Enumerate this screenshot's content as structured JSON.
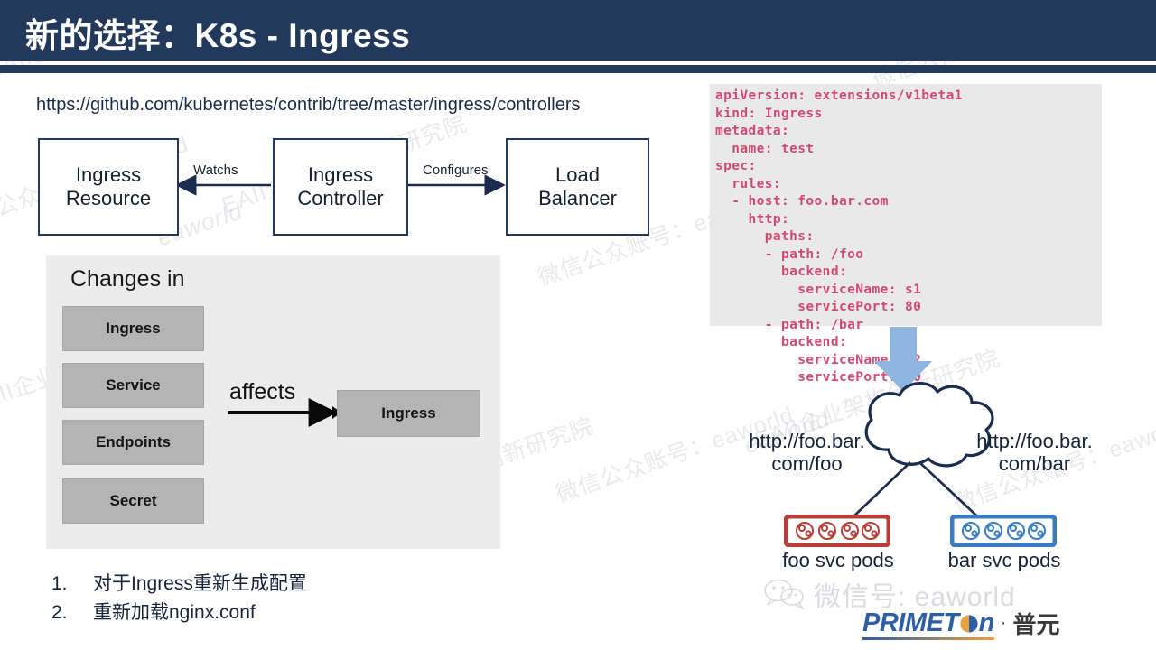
{
  "header": {
    "title": "新的选择：K8s - Ingress",
    "bar_color": "#22395c"
  },
  "reference_url": "https://github.com/kubernetes/contrib/tree/master/ingress/controllers",
  "flow_diagram": {
    "boxes": [
      {
        "id": "ingress-resource",
        "line1": "Ingress",
        "line2": "Resource"
      },
      {
        "id": "ingress-controller",
        "line1": "Ingress",
        "line2": "Controller"
      },
      {
        "id": "load-balancer",
        "line1": "Load",
        "line2": "Balancer"
      }
    ],
    "edges": [
      {
        "id": "watchs",
        "label": "Watchs"
      },
      {
        "id": "configures",
        "label": "Configures"
      }
    ]
  },
  "changes_panel": {
    "title": "Changes in",
    "items": [
      "Ingress",
      "Service",
      "Endpoints",
      "Secret"
    ],
    "arrow_label": "affects",
    "result": "Ingress"
  },
  "bullets": [
    {
      "num": "1.",
      "text": "对于Ingress重新生成配置"
    },
    {
      "num": "2.",
      "text": "重新加载nginx.conf"
    }
  ],
  "code_block": {
    "language": "yaml",
    "text_color": "#cf4a73",
    "background": "#e9e9e9",
    "content": "apiVersion: extensions/v1beta1\nkind: Ingress\nmetadata:\n  name: test\nspec:\n  rules:\n  - host: foo.bar.com\n    http:\n      paths:\n      - path: /foo\n        backend:\n          serviceName: s1\n          servicePort: 80\n      - path: /bar\n        backend:\n          serviceName: s2\n          servicePort: 80"
  },
  "cloud_diagram": {
    "arrow_color": "#8fb6de",
    "cloud_stroke": "#1b2c4e",
    "routes": [
      {
        "id": "foo",
        "url_line1": "http://foo.bar.",
        "url_line2": "com/foo",
        "pods_label": "foo svc pods",
        "color": "#b5403a",
        "pod_count": 4
      },
      {
        "id": "bar",
        "url_line1": "http://foo.bar.",
        "url_line2": "com/bar",
        "pods_label": "bar svc pods",
        "color": "#3a7cc0",
        "pod_count": 4
      }
    ]
  },
  "branding": {
    "wechat_watermark": "微信号: eaworld",
    "logo_word": "PRIMET",
    "logo_word_tail": "n",
    "logo_dot": "·",
    "logo_cn": "普元"
  },
  "watermarks": {
    "cn": "微信公众账号：eaworld",
    "cn2": "EAII企业架构创新研究院",
    "lat": "eaworld"
  }
}
